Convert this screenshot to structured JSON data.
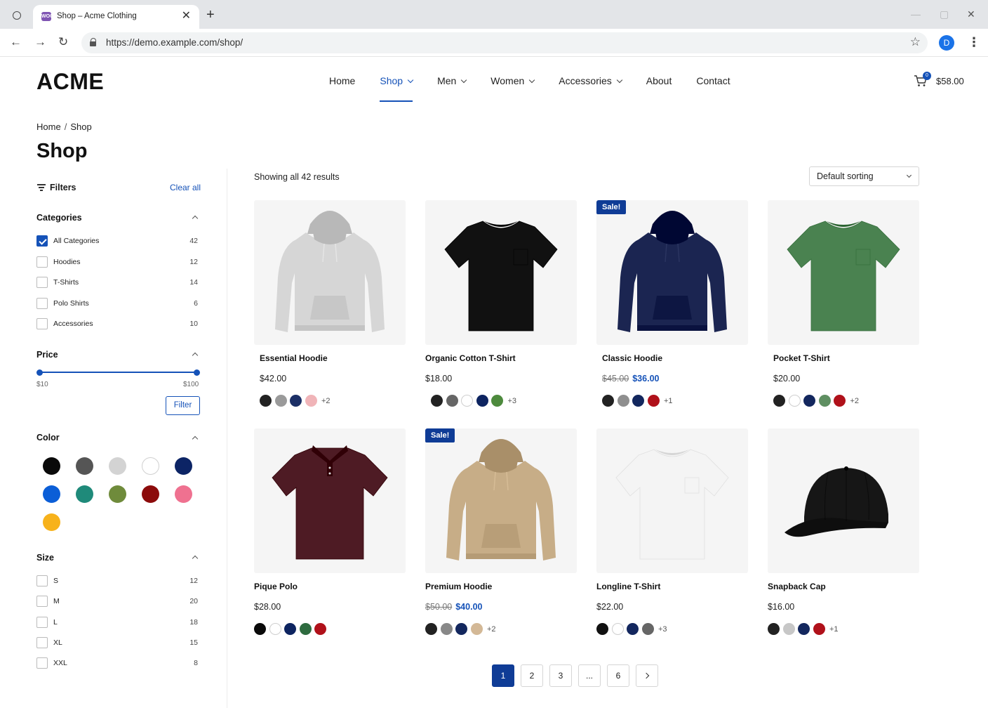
{
  "browser": {
    "tab_title": "Shop – Acme Clothing",
    "favicon_text": "WOO",
    "url": "https://demo.example.com/shop/",
    "profile_initial": "D"
  },
  "site": {
    "logo": "ACME",
    "nav": [
      "Home",
      "Shop",
      "Men",
      "Women",
      "Accessories",
      "About",
      "Contact"
    ],
    "active_nav": "Shop",
    "cart_count": "0",
    "cart_total": "$58.00"
  },
  "breadcrumb": {
    "home": "Home",
    "separator": "/",
    "current": "Shop"
  },
  "page_title": "Shop",
  "sidebar": {
    "filters_label": "Filters",
    "clear_all": "Clear all",
    "categories": {
      "title": "Categories",
      "items": [
        {
          "label": "All Categories",
          "count": "42",
          "checked": true
        },
        {
          "label": "Hoodies",
          "count": "12",
          "checked": false
        },
        {
          "label": "T-Shirts",
          "count": "14",
          "checked": false
        },
        {
          "label": "Polo Shirts",
          "count": "6",
          "checked": false
        },
        {
          "label": "Accessories",
          "count": "10",
          "checked": false
        }
      ]
    },
    "price": {
      "title": "Price",
      "min_label": "$10",
      "max_label": "$100",
      "button": "Filter"
    },
    "color": {
      "title": "Color",
      "swatches": [
        "#0a0a0a",
        "#555555",
        "#d3d3d3",
        "#ffffff",
        "#0c2465",
        "#0b5ed7",
        "#1f8a7a",
        "#6f8b3b",
        "#8c0b0b",
        "#ef7190",
        "#f7b21b"
      ]
    },
    "size": {
      "title": "Size",
      "items": [
        {
          "label": "S",
          "count": "12"
        },
        {
          "label": "M",
          "count": "20"
        },
        {
          "label": "L",
          "count": "18"
        },
        {
          "label": "XL",
          "count": "15"
        },
        {
          "label": "XXL",
          "count": "8"
        }
      ]
    }
  },
  "results": {
    "text": "Showing all 42 results",
    "sorting": "Default sorting"
  },
  "products": [
    {
      "name": "Essential Hoodie",
      "price": "$42.00",
      "sale": false,
      "kind": "hoodie",
      "color": "#d6d6d6",
      "swatches": [
        "#222222",
        "#9a9a9a",
        "#1c2f66",
        "#f0b4b8"
      ],
      "more": "+2"
    },
    {
      "name": "Organic Cotton T-Shirt",
      "price": "$18.00",
      "sale": false,
      "kind": "tshirt",
      "color": "#111111",
      "swatches": [
        "#222222",
        "#666666",
        "#ffffff",
        "#0d2460",
        "#4d8a3d"
      ],
      "more": "+3"
    },
    {
      "name": "Classic Hoodie",
      "old_price": "$45.00",
      "price": "$36.00",
      "sale": true,
      "sale_label": "Sale!",
      "kind": "hoodie",
      "color": "#1b2551",
      "swatches": [
        "#222222",
        "#8f8f8f",
        "#13275e",
        "#b0111a"
      ],
      "more": "+1"
    },
    {
      "name": "Pocket T-Shirt",
      "price": "$20.00",
      "sale": false,
      "kind": "tshirt",
      "color": "#4a8250",
      "swatches": [
        "#222222",
        "#ffffff",
        "#13275e",
        "#5f8f62",
        "#b0111a"
      ],
      "more": "+2"
    },
    {
      "name": "Pique Polo",
      "price": "$28.00",
      "sale": false,
      "kind": "polo",
      "color": "#4e1b24",
      "swatches": [
        "#0a0a0a",
        "#ffffff",
        "#0d2460",
        "#2e6b3f",
        "#b0111a"
      ],
      "more": ""
    },
    {
      "name": "Premium Hoodie",
      "old_price": "$50.00",
      "price": "$40.00",
      "sale": true,
      "sale_label": "Sale!",
      "kind": "hoodie",
      "color": "#c7ad87",
      "swatches": [
        "#222222",
        "#888888",
        "#13275e",
        "#d3b896"
      ],
      "more": "+2"
    },
    {
      "name": "Longline T-Shirt",
      "price": "$22.00",
      "sale": false,
      "kind": "tshirt",
      "color": "#f4f4f4",
      "swatches": [
        "#111111",
        "#ffffff",
        "#13275e",
        "#666666"
      ],
      "more": "+3"
    },
    {
      "name": "Snapback Cap",
      "price": "$16.00",
      "sale": false,
      "kind": "cap",
      "color": "#161616",
      "swatches": [
        "#222222",
        "#c7c7c7",
        "#13275e",
        "#b0111a"
      ],
      "more": "+1"
    }
  ],
  "pagination": {
    "pages": [
      "1",
      "2",
      "3",
      "...",
      "6"
    ],
    "current": "1"
  }
}
